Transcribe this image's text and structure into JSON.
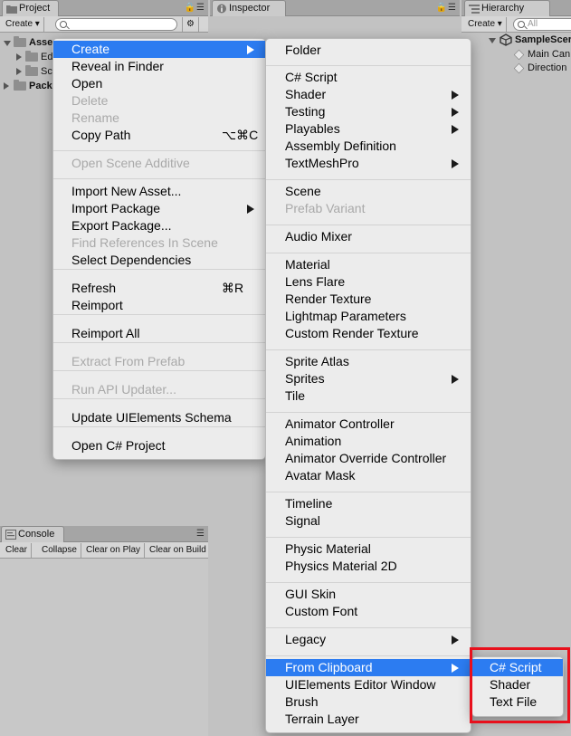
{
  "project": {
    "tab": "Project",
    "create": "Create ▾",
    "tree": [
      "Asse",
      "Ed",
      "Sc",
      "Pack"
    ]
  },
  "inspector": {
    "tab": "Inspector"
  },
  "hierarchy": {
    "tab": "Hierarchy",
    "create": "Create ▾",
    "search_placeholder": "All",
    "scene": "SampleScer",
    "items": [
      "Main Can",
      "Direction"
    ]
  },
  "console": {
    "tab": "Console",
    "buttons": [
      "Clear",
      "Collapse",
      "Clear on Play",
      "Clear on Build"
    ]
  },
  "context_menu": [
    {
      "label": "Create",
      "active": true,
      "submenu": true
    },
    {
      "label": "Reveal in Finder"
    },
    {
      "label": "Open"
    },
    {
      "label": "Delete",
      "disabled": true
    },
    {
      "label": "Rename",
      "disabled": true
    },
    {
      "label": "Copy Path",
      "shortcut": "⌥⌘C"
    },
    {
      "label": "Open Scene Additive",
      "disabled": true
    },
    {
      "label": "Import New Asset..."
    },
    {
      "label": "Import Package",
      "submenu": true
    },
    {
      "label": "Export Package..."
    },
    {
      "label": "Find References In Scene",
      "disabled": true
    },
    {
      "label": "Select Dependencies"
    },
    {
      "label": "Refresh",
      "shortcut": "⌘R"
    },
    {
      "label": "Reimport"
    },
    {
      "label": "Reimport All"
    },
    {
      "label": "Extract From Prefab",
      "disabled": true
    },
    {
      "label": "Run API Updater...",
      "disabled": true
    },
    {
      "label": "Update UIElements Schema"
    },
    {
      "label": "Open C# Project"
    }
  ],
  "create_menu": [
    {
      "label": "Folder"
    },
    {
      "label": "C# Script"
    },
    {
      "label": "Shader",
      "submenu": true
    },
    {
      "label": "Testing",
      "submenu": true
    },
    {
      "label": "Playables",
      "submenu": true
    },
    {
      "label": "Assembly Definition"
    },
    {
      "label": "TextMeshPro",
      "submenu": true
    },
    {
      "label": "Scene"
    },
    {
      "label": "Prefab Variant",
      "disabled": true
    },
    {
      "label": "Audio Mixer"
    },
    {
      "label": "Material"
    },
    {
      "label": "Lens Flare"
    },
    {
      "label": "Render Texture"
    },
    {
      "label": "Lightmap Parameters"
    },
    {
      "label": "Custom Render Texture"
    },
    {
      "label": "Sprite Atlas"
    },
    {
      "label": "Sprites",
      "submenu": true
    },
    {
      "label": "Tile"
    },
    {
      "label": "Animator Controller"
    },
    {
      "label": "Animation"
    },
    {
      "label": "Animator Override Controller"
    },
    {
      "label": "Avatar Mask"
    },
    {
      "label": "Timeline"
    },
    {
      "label": "Signal"
    },
    {
      "label": "Physic Material"
    },
    {
      "label": "Physics Material 2D"
    },
    {
      "label": "GUI Skin"
    },
    {
      "label": "Custom Font"
    },
    {
      "label": "Legacy",
      "submenu": true
    },
    {
      "label": "From Clipboard",
      "active": true,
      "submenu": true
    },
    {
      "label": "UIElements Editor Window"
    },
    {
      "label": "Brush"
    },
    {
      "label": "Terrain Layer"
    }
  ],
  "clipboard_menu": [
    {
      "label": "C# Script",
      "active": true
    },
    {
      "label": "Shader"
    },
    {
      "label": "Text File"
    }
  ],
  "colors": {
    "highlight": "#2c7cf1",
    "callout": "#e8101c",
    "panel": "#c2c2c2"
  }
}
